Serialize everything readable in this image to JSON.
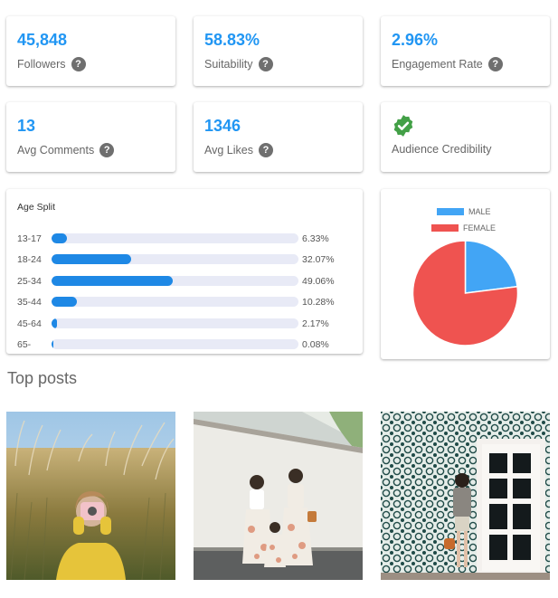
{
  "stats": [
    {
      "value": "45,848",
      "label": "Followers",
      "help": "?"
    },
    {
      "value": "58.83%",
      "label": "Suitability",
      "help": "?"
    },
    {
      "value": "2.96%",
      "label": "Engagement Rate",
      "help": "?"
    },
    {
      "value": "13",
      "label": "Avg Comments",
      "help": "?"
    },
    {
      "value": "1346",
      "label": "Avg Likes",
      "help": "?"
    },
    {
      "label": "Audience Credibility",
      "icon": "verified-check-icon"
    }
  ],
  "age_split": {
    "title": "Age Split",
    "rows": [
      {
        "label": "13-17",
        "percent": 6.33,
        "text": "6.33%"
      },
      {
        "label": "18-24",
        "percent": 32.07,
        "text": "32.07%"
      },
      {
        "label": "25-34",
        "percent": 49.06,
        "text": "49.06%"
      },
      {
        "label": "35-44",
        "percent": 10.28,
        "text": "10.28%"
      },
      {
        "label": "45-64",
        "percent": 2.17,
        "text": "2.17%"
      },
      {
        "label": "65-",
        "percent": 0.08,
        "text": "0.08%"
      }
    ],
    "bar_color": "#1e88e5",
    "track_color": "#e8eaf6"
  },
  "gender": {
    "legend": [
      {
        "name": "MALE",
        "color": "#42a5f5",
        "fraction": 0.23
      },
      {
        "name": "FEMALE",
        "color": "#ef5350",
        "fraction": 0.77
      }
    ]
  },
  "top_posts": {
    "title": "Top posts",
    "posts": [
      {
        "description": "woman in yellow jacket taking photo in tall grass field"
      },
      {
        "description": "mother and two children in matching dresses by white wall"
      },
      {
        "description": "woman standing by white door against patterned tile wall"
      }
    ]
  },
  "colors": {
    "accent": "#2196f3",
    "help_icon": "#6f6f6f",
    "verified": "#43a047"
  }
}
